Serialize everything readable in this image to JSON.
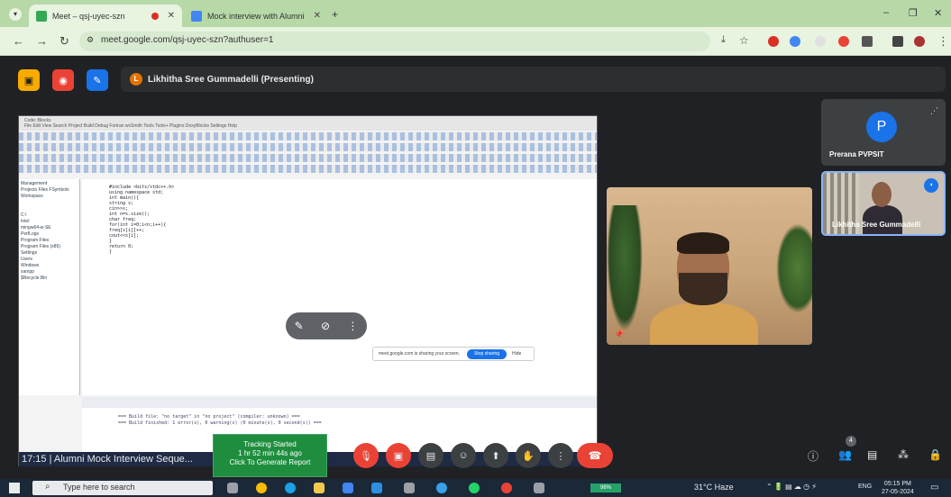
{
  "browser": {
    "tabs": [
      {
        "title": "Meet – qsj-uyec-szn",
        "active": true
      },
      {
        "title": "Mock interview with Alumni",
        "active": false
      }
    ],
    "url": "meet.google.com/qsj-uyec-szn?authuser=1",
    "win_min": "–",
    "win_max": "❐",
    "win_close": "✕"
  },
  "meet": {
    "presenting_label": "Likhitha Sree Gummadelli (Presenting)",
    "presenter_initial": "L",
    "participants": [
      {
        "name": "Prerana PVPSIT",
        "initial": "P",
        "avatar_color": "#1a73e8"
      },
      {
        "name": "Likhitha Sree Gummadelli"
      }
    ],
    "meeting_time": "17:15",
    "meeting_title": "Alumni Mock Interview Seque...",
    "tracking": {
      "line1": "Tracking Started",
      "line2": "1 hr 52 min 44s ago",
      "line3": "Click To Generate Report"
    },
    "people_count": "4",
    "accent": "#1a73e8",
    "end_color": "#ea4335"
  },
  "shared_screen": {
    "ide_title": "Code::Blocks",
    "menu": "File  Edit  View  Search  Project  Build  Debug  Fortran  wxSmith  Tools  Tools+  Plugins  DoxyBlocks  Settings  Help",
    "left_panel": [
      "Management",
      "Projects  Files  FSymbols",
      "Workspace",
      "C:\\",
      "Intel",
      "mingw64-w-SE",
      "PerfLogs",
      "Program Files",
      "Program Files (x86)",
      "Settings",
      "Users",
      "Windows",
      "xampp",
      "$Recycle.Bin"
    ],
    "code_lines": [
      "#include <bits/stdc++.h>",
      "using namespace std;",
      "int main(){",
      "    string s;",
      "    cin>>s;",
      "    int n=s.size();",
      "    char freq;",
      "    for(int i=0;i<n;i++){",
      "        freq[s[i]]++;",
      "        cout<<s[i];",
      "    }",
      "    return 0;",
      "}"
    ],
    "log_lines": [
      "=== Build file: \"no target\" in \"no project\" (compiler: unknown) ===",
      "=== Build finished: 1 error(s), 0 warning(s) (0 minute(s), 0 second(s)) ==="
    ],
    "share_popup_text": "meet.google.com is sharing your screen.",
    "share_stop": "Stop sharing",
    "share_hide": "Hide"
  },
  "taskbar": {
    "search_placeholder": "Type here to search",
    "weather": "31°C  Haze",
    "lang": "ENG",
    "time": "05:15 PM",
    "date": "27-05-2024",
    "battery": "96%"
  }
}
